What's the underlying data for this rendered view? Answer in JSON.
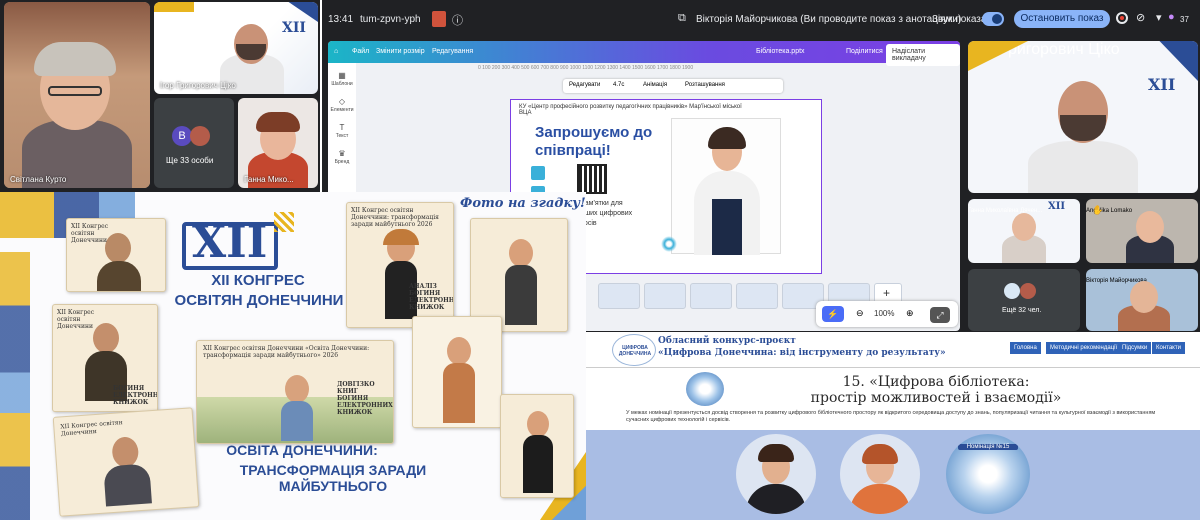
{
  "top_left_call": {
    "tiles": [
      {
        "name": "Світлана Курто"
      },
      {
        "name": "Ігор Григорович Ціко"
      },
      {
        "avatar_letter": "B",
        "more_label": "Ще 33 особи"
      },
      {
        "name": "Ганна Мико..."
      }
    ]
  },
  "meet": {
    "time": "13:41",
    "meeting_code": "tum-zpvn-yph",
    "presenter_text": "Вікторія Майорчикова (Ви проводите показ з анотаціями)",
    "sound_label": "Звук показа",
    "stop_button": "Остановить показ",
    "participant_count": "37",
    "canva": {
      "menu": [
        "Файл",
        "Змінити розмір",
        "Редагування"
      ],
      "doc_title": "Бібліотека.pptx",
      "share": "Поділитися",
      "publish": "Надіслати викладачу",
      "sidebar": [
        "Шаблони",
        "Елементи",
        "Текст",
        "Бренд"
      ],
      "tools": [
        "Редагувати",
        "4.7с",
        "Анімація",
        "Розташування"
      ],
      "ruler": "0 100 200 300 400 500 600 700 800 900 1000 1100 1200 1300 1400 1500 1600 1700 1800 1900",
      "slide_header": "КУ «Центр професійного розвитку педагогічних працівників» Мар'їнської міської ВЦА",
      "slide_title": "Запрошуємо до співпраці!",
      "slide_text_1": "пам'ятки для",
      "slide_text_2": "ваших цифрових",
      "slide_text_3": "сурсів",
      "zoom": "100%"
    },
    "side_tiles": [
      {
        "name": "Ігор Григорович Ціко"
      },
      {
        "name": "Ганна Миколаївна Дячен..."
      },
      {
        "name": "Angelika Lomako"
      },
      {
        "more_label": "Ещё 32 чел."
      },
      {
        "name": "Вікторія Майорчикова"
      }
    ]
  },
  "congress": {
    "logo_numeral": "XII",
    "title_line1": "XII КОНГРЕС",
    "title_line2": "ОСВІТЯН ДОНЕЧЧИНИ",
    "subtitle_line1": "ОСВІТА ДОНЕЧЧИНИ:",
    "subtitle_line2": "ТРАНСФОРМАЦІЯ ЗАРАДИ МАЙБУТНЬОГО",
    "photo_caption": "Фото на згадку!",
    "card_text_a": "XII Конгрес освітян Донеччини: трансформація заради майбутнього 2026",
    "card_text_b": "XII Конгрес освітян Донеччини «Освіта Донеччини: трансформація заради майбутнього» 2026",
    "card_text_c": "АНАЛІЗ БОГИНЯ ЕЛЕКТРОННИХ КНИЖОК",
    "card_text_d": "ДОВГІЗКО КНИГ БОГИНЯ ЕЛЕКТРОННИХ КНИЖОК",
    "card_text_e": "БОГИНЯ ЕЛЕКТРОННИХ КНИЖОК",
    "card_text_f": "XII Конгрес освітян Донеччини"
  },
  "site": {
    "contest_line1": "Обласний конкурс-проєкт",
    "contest_line2": "«Цифрова Донеччина: від інструменту до результату»",
    "logo_text": "ЦИФРОВА ДОНЕЧЧИНА",
    "nav": [
      "Головна",
      "Методичні рекомендації",
      "Підсумки",
      "Контакти"
    ],
    "heading_line1": "15. «Цифрова бібліотека:",
    "heading_line2": "простір можливостей і взаємодії»",
    "description": "У межах номінації презентується досвід створення та розвитку цифрового бібліотечного простору як відкритого середовища доступу до знань, популяризації читання та культурної взаємодії з використанням сучасних цифрових технологій і сервісів.",
    "badge": "Номінація №15"
  },
  "colors": {
    "accent_blue": "#2b4d96",
    "gold": "#e8b520",
    "meet_blue": "#8ab4f8",
    "canva_purple": "#7b3fe4"
  }
}
